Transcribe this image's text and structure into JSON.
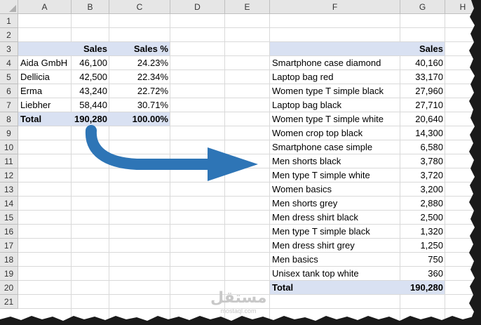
{
  "columns": [
    "A",
    "B",
    "C",
    "D",
    "E",
    "F",
    "G",
    "H"
  ],
  "rows": [
    "1",
    "2",
    "3",
    "4",
    "5",
    "6",
    "7",
    "8",
    "9",
    "10",
    "11",
    "12",
    "13",
    "14",
    "15",
    "16",
    "17",
    "18",
    "19",
    "20",
    "21"
  ],
  "left_table": {
    "header": {
      "sales": "Sales",
      "sales_pct": "Sales %"
    },
    "rows": [
      {
        "name": "Aida GmbH",
        "sales": "46,100",
        "pct": "24.23%"
      },
      {
        "name": "Dellicia",
        "sales": "42,500",
        "pct": "22.34%"
      },
      {
        "name": "Erma",
        "sales": "43,240",
        "pct": "22.72%"
      },
      {
        "name": "Liebher",
        "sales": "58,440",
        "pct": "30.71%"
      }
    ],
    "total": {
      "label": "Total",
      "sales": "190,280",
      "pct": "100.00%"
    }
  },
  "right_table": {
    "header": {
      "sales": "Sales"
    },
    "rows": [
      {
        "name": "Smartphone case diamond",
        "sales": "40,160"
      },
      {
        "name": "Laptop bag red",
        "sales": "33,170"
      },
      {
        "name": "Women type T simple black",
        "sales": "27,960"
      },
      {
        "name": "Laptop bag black",
        "sales": "27,710"
      },
      {
        "name": "Women type T simple white",
        "sales": "20,640"
      },
      {
        "name": "Women crop top black",
        "sales": "14,300"
      },
      {
        "name": "Smartphone case simple",
        "sales": "6,580"
      },
      {
        "name": "Men shorts black",
        "sales": "3,780"
      },
      {
        "name": "Men type T simple white",
        "sales": "3,720"
      },
      {
        "name": "Women basics",
        "sales": "3,200"
      },
      {
        "name": "Men shorts grey",
        "sales": "2,880"
      },
      {
        "name": "Men dress shirt black",
        "sales": "2,500"
      },
      {
        "name": "Men type T simple black",
        "sales": "1,320"
      },
      {
        "name": "Men dress shirt grey",
        "sales": "1,250"
      },
      {
        "name": "Men basics",
        "sales": "750"
      },
      {
        "name": "Unisex tank top white",
        "sales": "360"
      }
    ],
    "total": {
      "label": "Total",
      "sales": "190,280"
    }
  },
  "watermark": {
    "main": "مستقل",
    "sub": "mostaql.com"
  },
  "colors": {
    "band": "#d9e1f2",
    "arrow": "#2e75b6",
    "header_bg": "#e6e6e6",
    "grid": "#d9d9d9"
  },
  "icons": {
    "arrow": "curved-arrow-right-icon"
  }
}
